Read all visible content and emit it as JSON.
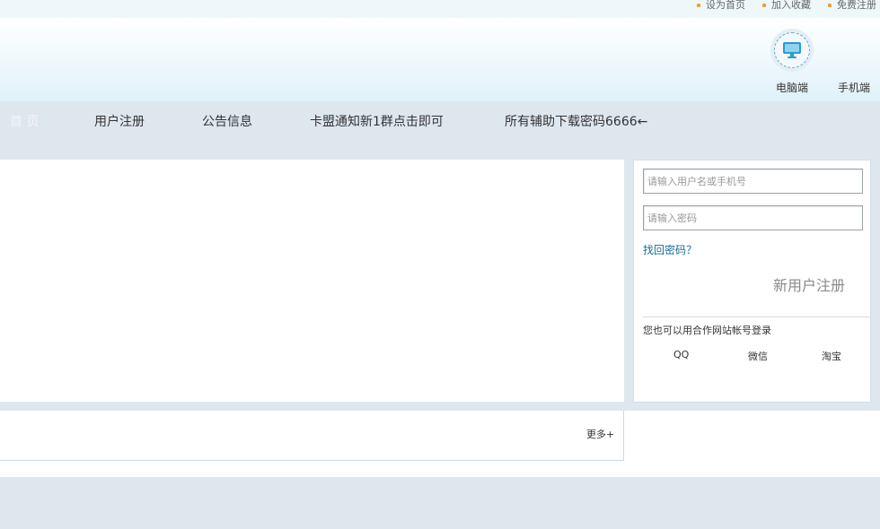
{
  "topbar": {
    "links": [
      "设为首页",
      "加入收藏",
      "免费注册"
    ]
  },
  "header": {
    "pc_label": "电脑端",
    "mobile_label": "手机端",
    "icon": "monitor-icon",
    "icon_color": "#2b9ccc"
  },
  "nav": {
    "items": [
      "首 页",
      "用户注册",
      "公告信息",
      "卡盟通知新1群点击即可",
      "所有辅助下载密码6666←"
    ]
  },
  "login": {
    "username_placeholder": "请输入用户名或手机号",
    "password_placeholder": "请输入密码",
    "forgot": "找回密码？",
    "register": "新用户注册",
    "partner_text": "您也可以用合作网站帐号登录",
    "providers": [
      "QQ",
      "微信",
      "淘宝"
    ]
  },
  "news": {
    "more": "更多+"
  }
}
